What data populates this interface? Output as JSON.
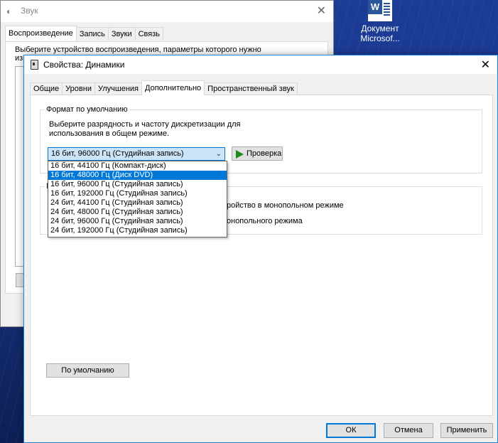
{
  "desktop": {
    "icon_label_line1": "Документ",
    "icon_label_line2": "Microsof..."
  },
  "sound_window": {
    "title": "Звук",
    "tabs": [
      "Воспроизведение",
      "Запись",
      "Звуки",
      "Связь"
    ],
    "description": "Выберите устройство воспроизведения, параметры которого нужно",
    "description_line2": "изм"
  },
  "dialog": {
    "title": "Свойства: Динамики",
    "tabs": [
      "Общие",
      "Уровни",
      "Улучшения",
      "Дополнительно",
      "Пространственный звук"
    ],
    "active_tab_index": 3,
    "format_group": {
      "legend": "Формат по умолчанию",
      "description_line1": "Выберите разрядность и частоту дискретизации для",
      "description_line2": "использования в общем режиме.",
      "combo_value": "16 бит, 96000 Гц (Студийная запись)",
      "test_button": "Проверка",
      "options": [
        "16 бит, 44100 Гц (Компакт-диск)",
        "16 бит, 48000 Гц (Диск DVD)",
        "16 бит, 96000 Гц (Студийная запись)",
        "16 бит, 192000 Гц (Студийная запись)",
        "24 бит, 44100 Гц (Студийная запись)",
        "24 бит, 48000 Гц (Студийная запись)",
        "24 бит, 96000 Гц (Студийная запись)",
        "24 бит, 192000 Гц (Студийная запись)"
      ],
      "highlighted_option_index": 1
    },
    "mono_group": {
      "legend": "М",
      "line1": "ройство в монопольном режиме",
      "line2": "онопольного режима"
    },
    "default_button": "По умолчанию",
    "ok_button": "ОК",
    "cancel_button": "Отмена",
    "apply_button": "Применить"
  }
}
